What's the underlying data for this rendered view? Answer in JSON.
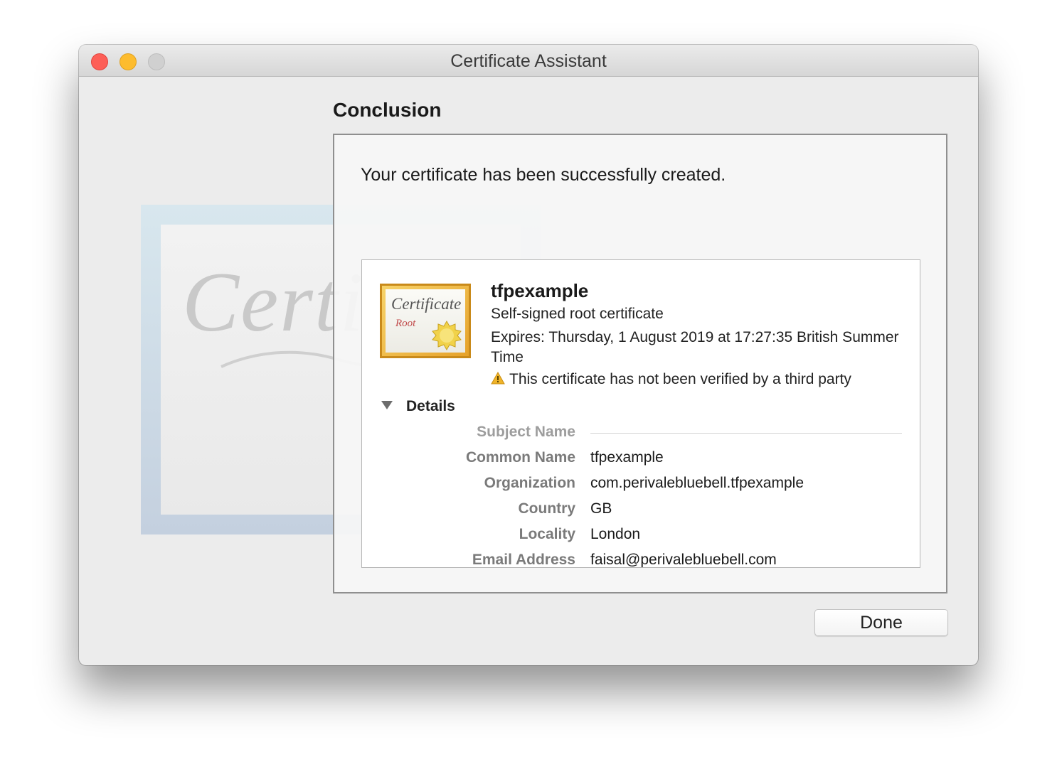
{
  "window": {
    "title": "Certificate Assistant"
  },
  "background_art": {
    "script_text": "Certifi"
  },
  "heading": "Conclusion",
  "message": "Your certificate has been successfully created.",
  "certificate": {
    "icon_word": "Certificate",
    "icon_sub": "Root",
    "name": "tfpexample",
    "type": "Self-signed root certificate",
    "expires": "Expires: Thursday, 1 August 2019 at 17:27:35 British Summer Time",
    "warning": "This certificate has not been verified by a third party"
  },
  "details": {
    "toggle_label": "Details",
    "section_title": "Subject Name",
    "rows": [
      {
        "label": "Common Name",
        "value": "tfpexample"
      },
      {
        "label": "Organization",
        "value": "com.perivalebluebell.tfpexample"
      },
      {
        "label": "Country",
        "value": "GB"
      },
      {
        "label": "Locality",
        "value": "London"
      },
      {
        "label": "Email Address",
        "value": "faisal@perivalebluebell.com"
      }
    ]
  },
  "buttons": {
    "done": "Done"
  },
  "icons": {
    "close": "close-icon",
    "minimize": "minimize-icon",
    "zoom": "zoom-icon",
    "warning": "warning-icon",
    "disclosure": "disclosure-triangle-icon",
    "certificate": "certificate-icon"
  },
  "colors": {
    "close": "#fd5f57",
    "minimize": "#fdbc2e",
    "zoom": "#d0d0d0",
    "warning": "#f0b429"
  }
}
